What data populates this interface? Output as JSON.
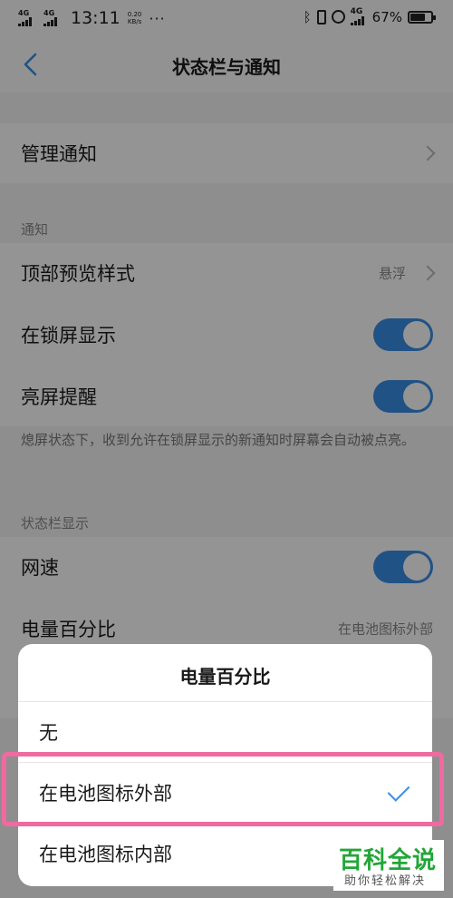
{
  "status_bar": {
    "net1": "4G",
    "net2": "4G",
    "time": "13:11",
    "speed_value": "0.20",
    "speed_unit": "KB/s",
    "dots": "···",
    "lte": "4G",
    "battery_pct": "67%",
    "battery_level": 0.67
  },
  "header": {
    "title": "状态栏与通知"
  },
  "rows": {
    "manage": {
      "label": "管理通知"
    },
    "section_notify": "通知",
    "preview": {
      "label": "顶部预览样式",
      "value": "悬浮"
    },
    "lockscreen": {
      "label": "在锁屏显示",
      "on": true
    },
    "wake": {
      "label": "亮屏提醒",
      "on": true
    },
    "wake_note": "熄屏状态下，收到允许在锁屏显示的新通知时屏幕会自动被点亮。",
    "section_statusbar": "状态栏显示",
    "netspeed": {
      "label": "网速",
      "on": true
    },
    "battery": {
      "label": "电量百分比",
      "value": "在电池图标外部"
    }
  },
  "sheet": {
    "title": "电量百分比",
    "options": [
      {
        "label": "无",
        "selected": false
      },
      {
        "label": "在电池图标外部",
        "selected": true
      },
      {
        "label": "在电池图标内部",
        "selected": false
      }
    ]
  },
  "watermark": {
    "main": "百科全说",
    "sub": "助你轻松解决"
  },
  "colors": {
    "accent": "#3a8ee6",
    "highlight": "#f06aa0",
    "watermark": "#22a638"
  }
}
